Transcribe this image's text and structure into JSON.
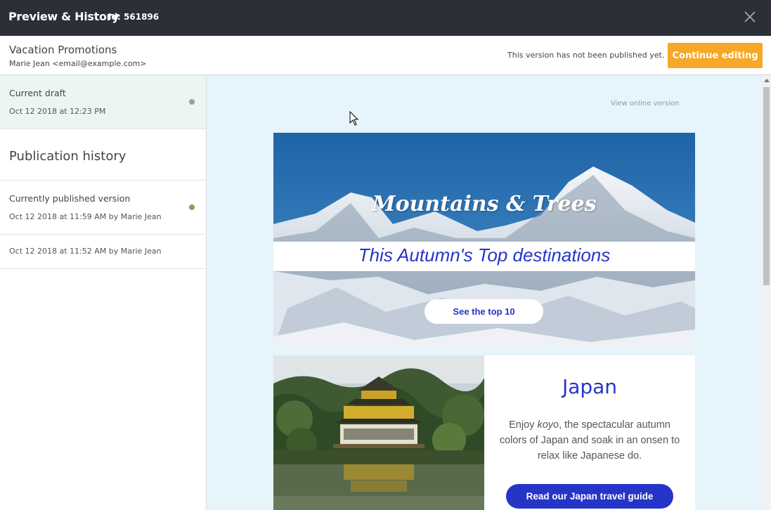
{
  "topbar": {
    "title": "Preview & History",
    "id_label": "Id: 561896"
  },
  "header": {
    "campaign_name": "Vacation Promotions",
    "sender": "Marie Jean <email@example.com>",
    "status_text": "This version has not been published yet.",
    "continue_label": "Continue editing"
  },
  "sidebar": {
    "draft": {
      "label": "Current draft",
      "date": "Oct 12 2018 at 12:23 PM",
      "dot_color": "#9aa0a0"
    },
    "history_heading": "Publication history",
    "versions": [
      {
        "label": "Currently published version",
        "date": "Oct 12 2018 at 11:59 AM by Marie Jean",
        "dot_color": "#8aa04a"
      },
      {
        "label": "",
        "date": "Oct 12 2018 at 11:52 AM by Marie Jean"
      }
    ]
  },
  "preview": {
    "view_online": "View online version",
    "hero": {
      "title": "Mountains & Trees",
      "subtitle": "This Autumn's Top destinations",
      "button": "See the top 10"
    },
    "japan": {
      "title": "Japan",
      "text_before": "Enjoy ",
      "text_em": "koyo",
      "text_after": ", the spectacular autumn colors of Japan and soak in an onsen to relax like Japanese do.",
      "button": "Read our Japan travel guide"
    }
  },
  "colors": {
    "topbar_bg": "#2b2f38",
    "accent_orange": "#f7a826",
    "brand_blue": "#2535c8",
    "preview_bg": "#e6f4fb",
    "draft_bg": "#ebf5f1"
  }
}
